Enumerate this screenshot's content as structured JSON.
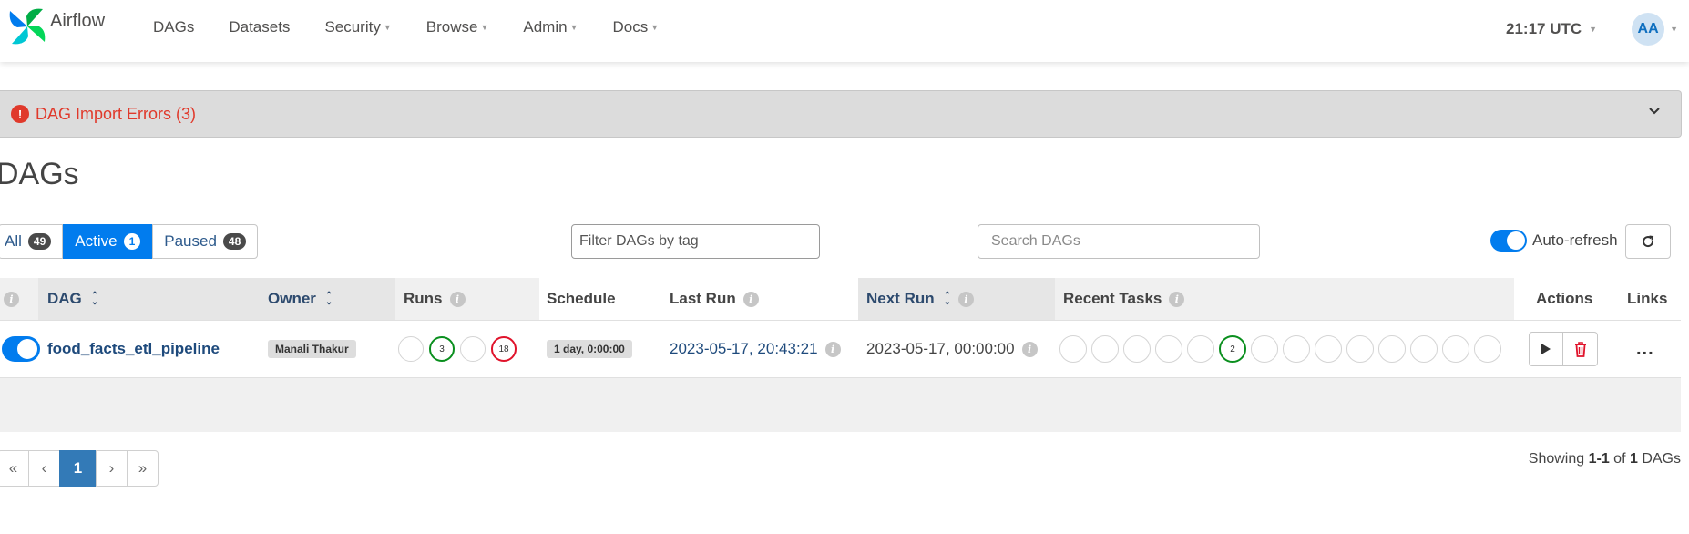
{
  "navbar": {
    "brand": "Airflow",
    "items": [
      {
        "label": "DAGs",
        "dropdown": false
      },
      {
        "label": "Datasets",
        "dropdown": false
      },
      {
        "label": "Security",
        "dropdown": true
      },
      {
        "label": "Browse",
        "dropdown": true
      },
      {
        "label": "Admin",
        "dropdown": true
      },
      {
        "label": "Docs",
        "dropdown": true
      }
    ],
    "clock": "21:17 UTC",
    "user_initials": "AA"
  },
  "import_errors": {
    "icon": "!",
    "label": "DAG Import Errors (3)"
  },
  "page_title": "DAGs",
  "filters": {
    "tabs": [
      {
        "label": "All",
        "count": "49",
        "active": false
      },
      {
        "label": "Active",
        "count": "1",
        "active": true
      },
      {
        "label": "Paused",
        "count": "48",
        "active": false
      }
    ],
    "tag_placeholder": "Filter DAGs by tag",
    "search_placeholder": "Search DAGs",
    "auto_refresh_label": "Auto-refresh",
    "auto_refresh_on": true
  },
  "table": {
    "headers": {
      "dag": "DAG",
      "owner": "Owner",
      "runs": "Runs",
      "schedule": "Schedule",
      "last_run": "Last Run",
      "next_run": "Next Run",
      "recent_tasks": "Recent Tasks",
      "actions": "Actions",
      "links": "Links"
    },
    "rows": [
      {
        "dag_id": "food_facts_etl_pipeline",
        "active": true,
        "owner": "Manali Thakur",
        "runs": [
          {
            "state": "queued",
            "count": ""
          },
          {
            "state": "success",
            "count": "3"
          },
          {
            "state": "running",
            "count": ""
          },
          {
            "state": "failed",
            "count": "18"
          }
        ],
        "schedule": "1 day, 0:00:00",
        "last_run": "2023-05-17, 20:43:21",
        "next_run": "2023-05-17, 00:00:00",
        "recent_tasks": [
          "",
          "",
          "",
          "",
          "",
          "2",
          "",
          "",
          "",
          "",
          "",
          "",
          "",
          ""
        ],
        "recent_tasks_success_index": 5,
        "links_label": "..."
      }
    ]
  },
  "pagination": {
    "first": "«",
    "prev": "‹",
    "current": "1",
    "next": "›",
    "last": "»"
  },
  "showing": {
    "prefix": "Showing",
    "range": "1-1",
    "of": "of",
    "total": "1",
    "suffix": "DAGs"
  },
  "colors": {
    "primary": "#017cee",
    "error": "#e0392b",
    "success": "#0a8f1e",
    "failed": "#e0132b"
  }
}
